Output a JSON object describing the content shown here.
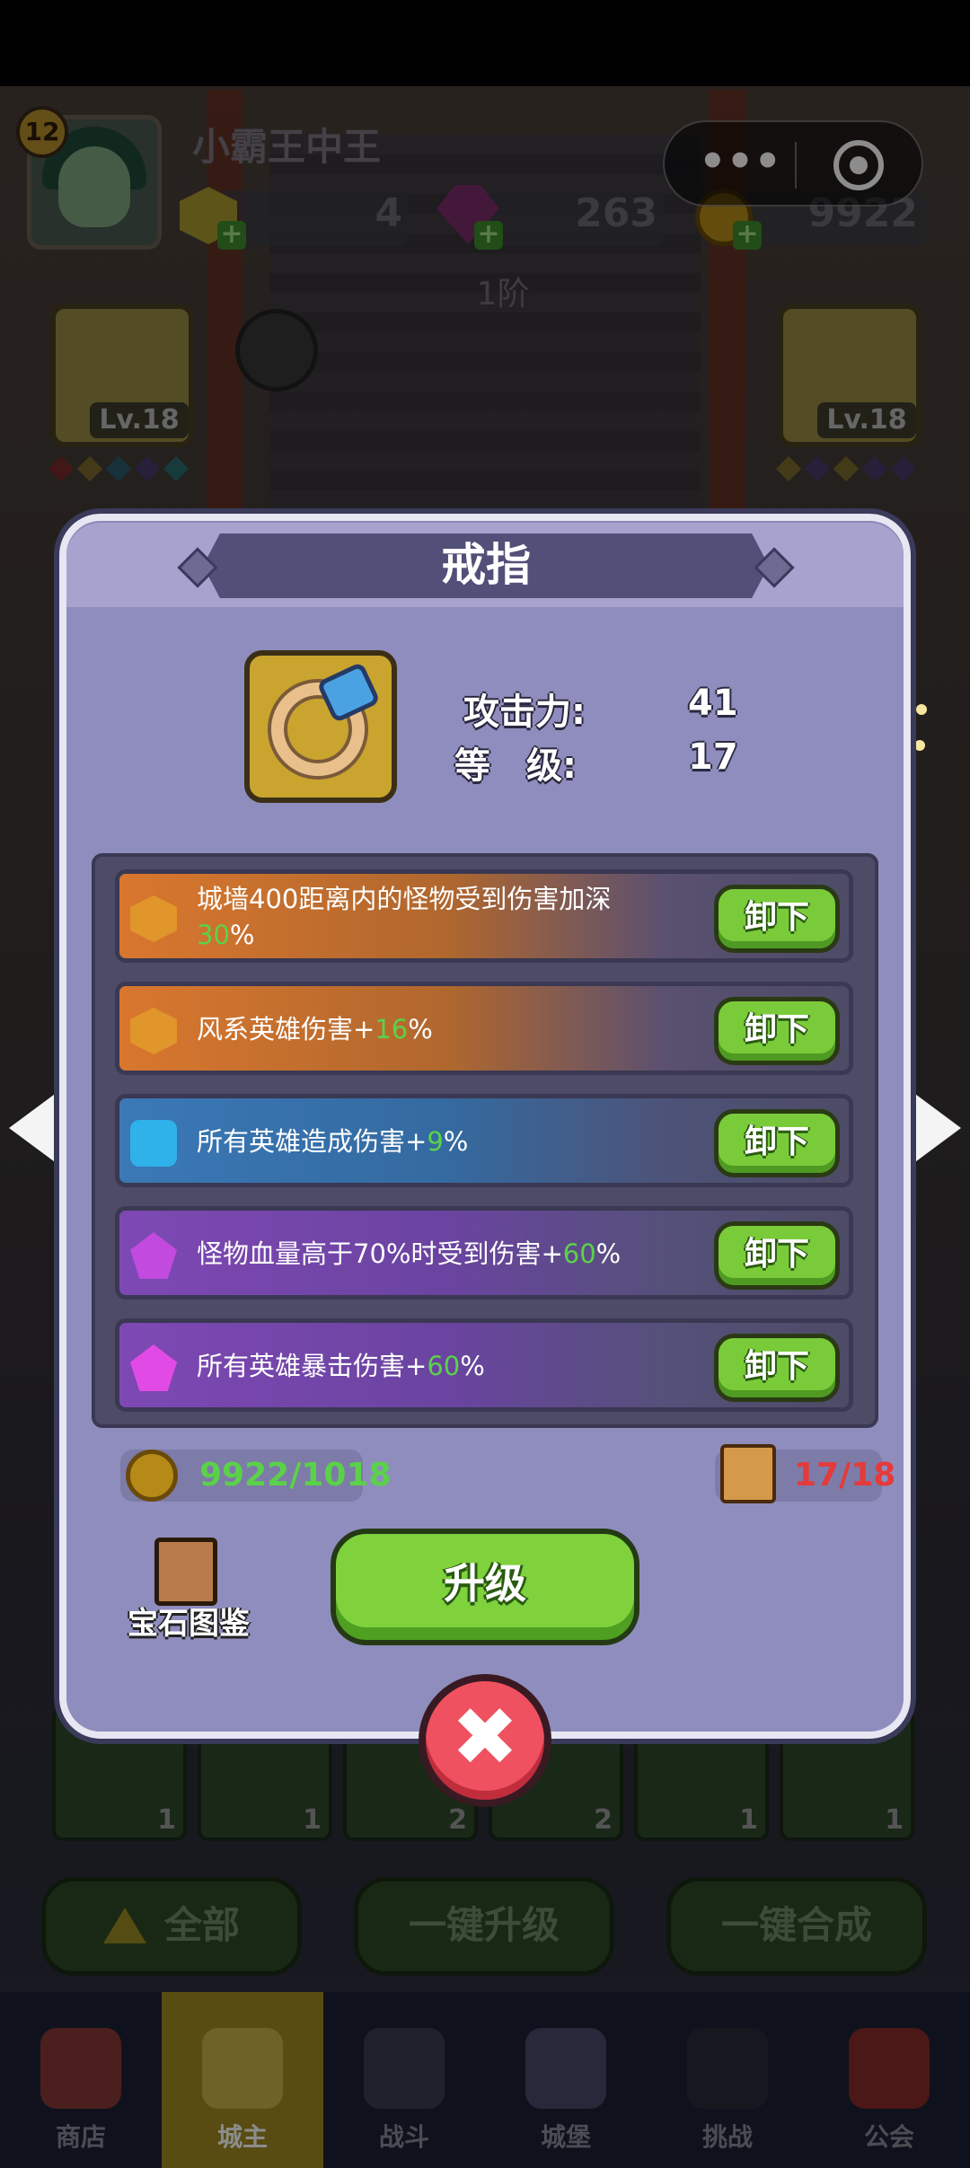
{
  "header": {
    "level": "12",
    "player_name": "小霸王中王",
    "resources": [
      {
        "name": "gold-gem",
        "value": "4"
      },
      {
        "name": "purple-gem",
        "value": "263"
      },
      {
        "name": "coin",
        "value": "9922"
      }
    ],
    "tier": "1阶",
    "left_slot_level": "Lv.18",
    "right_slot_level": "Lv.18"
  },
  "capsule": {
    "more": "•••"
  },
  "modal": {
    "title": "戒指",
    "stats": [
      {
        "label": "攻击力:",
        "value": "41"
      },
      {
        "label": "等　级:",
        "value": "17"
      }
    ],
    "gems": [
      {
        "icon": "orange-spiral-gem-icon",
        "text_before": "城墙400距离内的怪物受到伤害加深",
        "highlight": "30",
        "text_after": "%",
        "button": "卸下"
      },
      {
        "icon": "orange-hex-gem-icon",
        "text_before": "风系英雄伤害+",
        "highlight": "16",
        "text_after": "%",
        "button": "卸下"
      },
      {
        "icon": "blue-gem-icon",
        "text_before": "所有英雄造成伤害+",
        "highlight": "9",
        "text_after": "%",
        "button": "卸下"
      },
      {
        "icon": "purple-spiral-gem-icon",
        "text_before": "怪物血量高于70%时受到伤害+",
        "highlight": "60",
        "text_after": "%",
        "button": "卸下"
      },
      {
        "icon": "pink-gem-icon",
        "text_before": "所有英雄暴击伤害+",
        "highlight": "60",
        "text_after": "%",
        "button": "卸下"
      }
    ],
    "coin_cost": "9922/1018",
    "scroll_cost": "17/18",
    "gem_book_label": "宝石图鉴",
    "upgrade_label": "升级",
    "close_symbol": "✖"
  },
  "slots": [
    {
      "count": "1"
    },
    {
      "count": "1"
    },
    {
      "count": "2"
    },
    {
      "count": "2"
    },
    {
      "count": "1"
    },
    {
      "count": "1"
    }
  ],
  "bottom_buttons": {
    "all": "全部",
    "one_key_upgrade": "一键升级",
    "one_key_merge": "一键合成"
  },
  "nav": [
    {
      "label": "商店",
      "icon": "shop-icon"
    },
    {
      "label": "城主",
      "icon": "crown-icon",
      "active": true
    },
    {
      "label": "战斗",
      "icon": "swords-icon"
    },
    {
      "label": "城堡",
      "icon": "castle-icon"
    },
    {
      "label": "挑战",
      "icon": "demon-icon"
    },
    {
      "label": "公会",
      "icon": "banner-icon"
    }
  ],
  "colors": {
    "modal_bg": "#8b89b8",
    "button_green": "#7acb3a",
    "highlight_green": "#5bd14a",
    "close_red": "#ef5160",
    "cost_red": "#e53a3a"
  }
}
